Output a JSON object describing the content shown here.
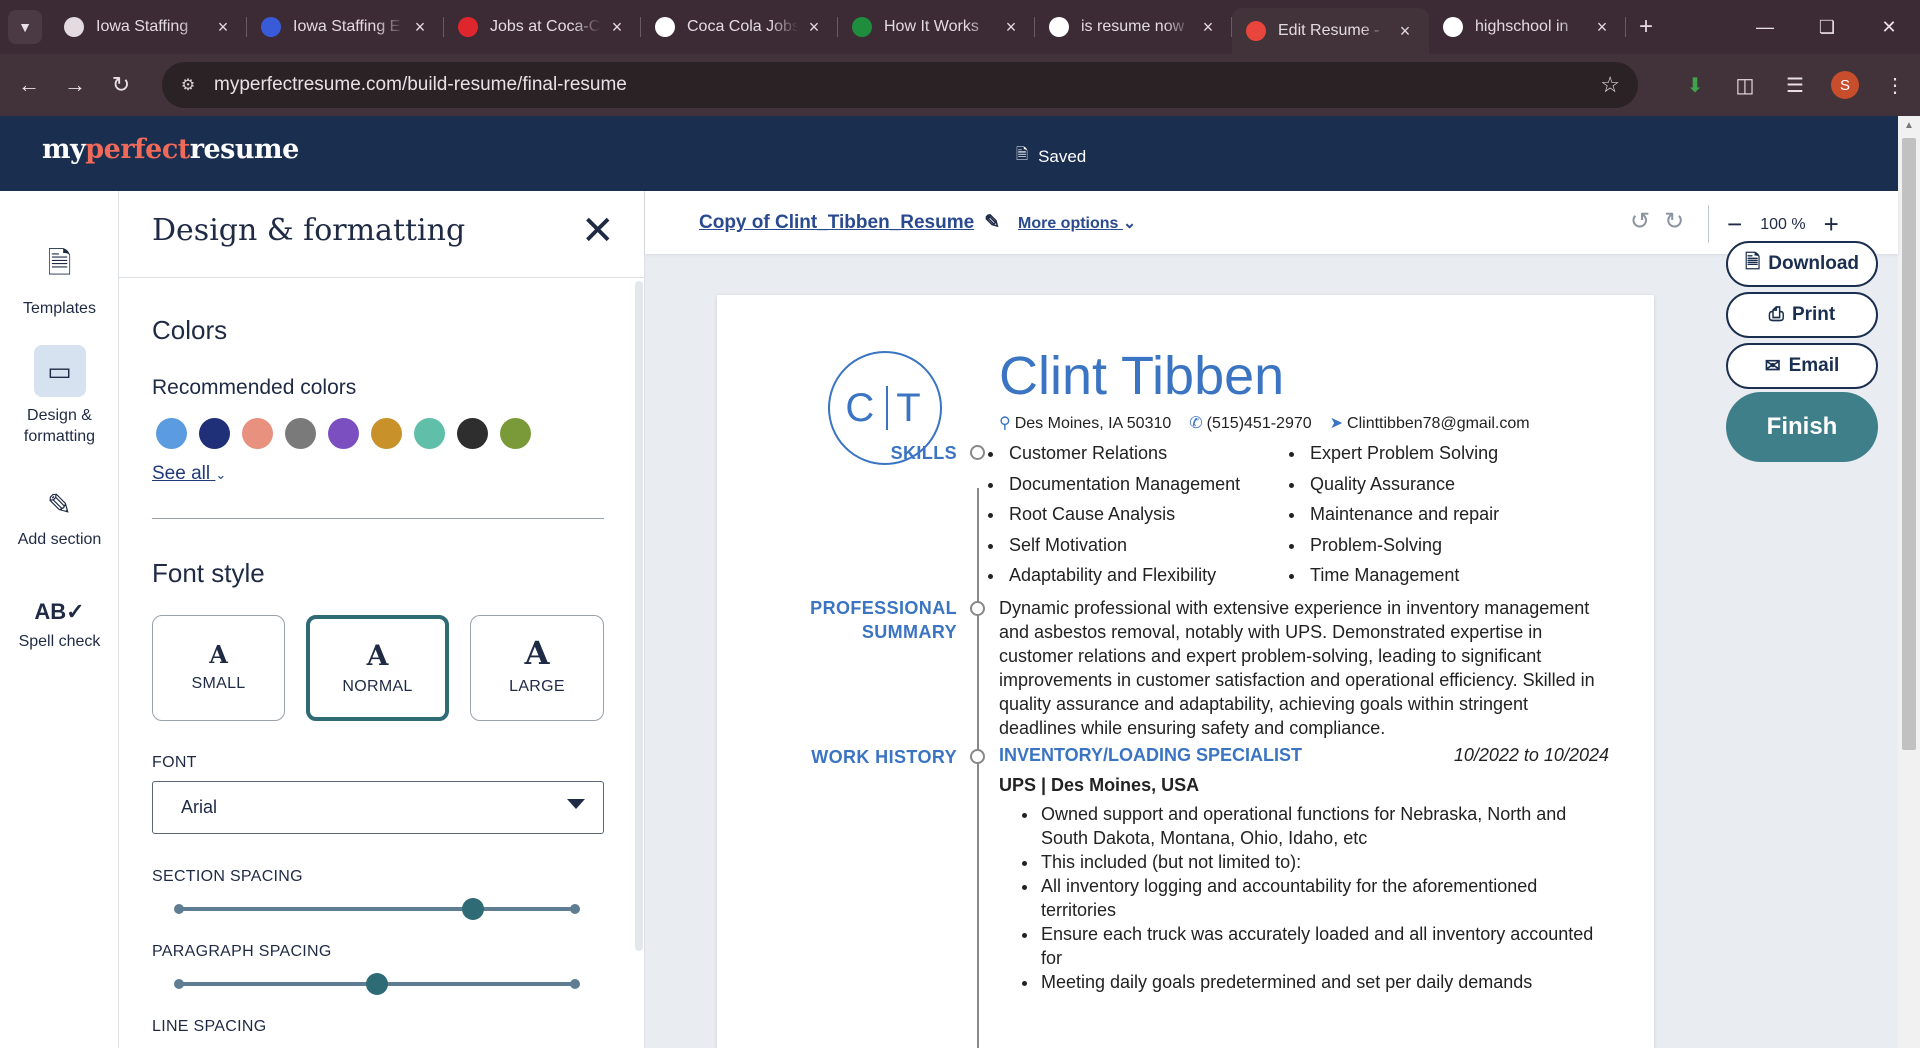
{
  "browser": {
    "tabs": [
      {
        "title": "Iowa Staffing",
        "favicon": "staffing-icon",
        "color": "#e3dbe0"
      },
      {
        "title": "Iowa Staffing E",
        "favicon": "staffing-logo-icon",
        "color": "#3a5bd9"
      },
      {
        "title": "Jobs at Coca-C",
        "favicon": "coca-cola-icon",
        "color": "#e0262d"
      },
      {
        "title": "Coca Cola Jobs",
        "favicon": "info-icon",
        "color": "#ffffff"
      },
      {
        "title": "How It Works",
        "favicon": "doc-icon",
        "color": "#1e8e3e"
      },
      {
        "title": "is resume now",
        "favicon": "google-icon",
        "color": "#ffffff"
      },
      {
        "title": "Edit Resume -",
        "favicon": "resume-icon",
        "color": "#e8453c",
        "active": true
      },
      {
        "title": "highschool in",
        "favicon": "google-icon",
        "color": "#ffffff"
      }
    ],
    "url": "myperfectresume.com/build-resume/final-resume",
    "profile_initial": "S"
  },
  "app": {
    "logo_part1": "my",
    "logo_part2": "perfect",
    "logo_part3": "resume",
    "status": "Saved"
  },
  "rail": {
    "items": [
      {
        "label": "Templates",
        "icon": "document-icon"
      },
      {
        "label": "Design & formatting",
        "icon": "paint-brush-icon",
        "active": true
      },
      {
        "label": "Add section",
        "icon": "edit-square-icon"
      },
      {
        "label": "Spell check",
        "icon": "spell-check-icon"
      }
    ]
  },
  "panel": {
    "title": "Design & formatting",
    "colors_heading": "Colors",
    "recommended_label": "Recommended colors",
    "swatches": [
      "#5b9be0",
      "#1f2f78",
      "#e8917f",
      "#7a7a7a",
      "#7b4fc0",
      "#c8912a",
      "#5fbfa8",
      "#2e2e2e",
      "#7a9a3a"
    ],
    "see_all": "See all",
    "font_style_heading": "Font style",
    "sizes": [
      {
        "glyph": "A",
        "label": "SMALL"
      },
      {
        "glyph": "A",
        "label": "NORMAL",
        "selected": true
      },
      {
        "glyph": "A",
        "label": "LARGE"
      }
    ],
    "font_label": "FONT",
    "font_value": "Arial",
    "section_spacing_label": "SECTION SPACING",
    "section_spacing_value": 0.74,
    "paragraph_spacing_label": "PARAGRAPH SPACING",
    "paragraph_spacing_value": 0.5,
    "line_spacing_label": "LINE SPACING"
  },
  "editor": {
    "doc_name": "Copy of Clint_Tibben_Resume",
    "more_options": "More options",
    "zoom": "100 %"
  },
  "resume": {
    "initial_first": "C",
    "initial_last": "T",
    "name": "Clint Tibben",
    "location": "Des Moines, IA 50310",
    "phone": "(515)451-2970",
    "email": "Clinttibben78@gmail.com",
    "skills_heading": "SKILLS",
    "skills_left": [
      "Customer Relations",
      "Documentation Management",
      "Root Cause Analysis",
      "Self Motivation",
      "Adaptability and Flexibility"
    ],
    "skills_right": [
      "Expert Problem Solving",
      "Quality Assurance",
      "Maintenance and repair",
      "Problem-Solving",
      "Time Management"
    ],
    "summary_heading_1": "PROFESSIONAL",
    "summary_heading_2": "SUMMARY",
    "summary": "Dynamic professional with extensive experience in inventory management and asbestos removal, notably with UPS. Demonstrated expertise in customer relations and expert problem-solving, leading to significant improvements in customer satisfaction and operational efficiency. Skilled in quality assurance and adaptability, achieving goals within stringent deadlines while ensuring safety and compliance.",
    "work_heading": "WORK HISTORY",
    "job_title": "INVENTORY/LOADING SPECIALIST",
    "job_dates": "10/2022 to 10/2024",
    "job_company": "UPS | Des Moines, USA",
    "job_bullets": [
      "Owned support and operational functions for Nebraska, North and South Dakota, Montana, Ohio, Idaho, etc",
      "This included (but not limited to):",
      "All inventory logging and accountability for the aforementioned territories",
      "Ensure each truck was accurately loaded and all inventory accounted for",
      "Meeting daily goals predetermined and set per daily demands"
    ]
  },
  "actions": {
    "download": "Download",
    "print": "Print",
    "email": "Email",
    "finish": "Finish"
  }
}
